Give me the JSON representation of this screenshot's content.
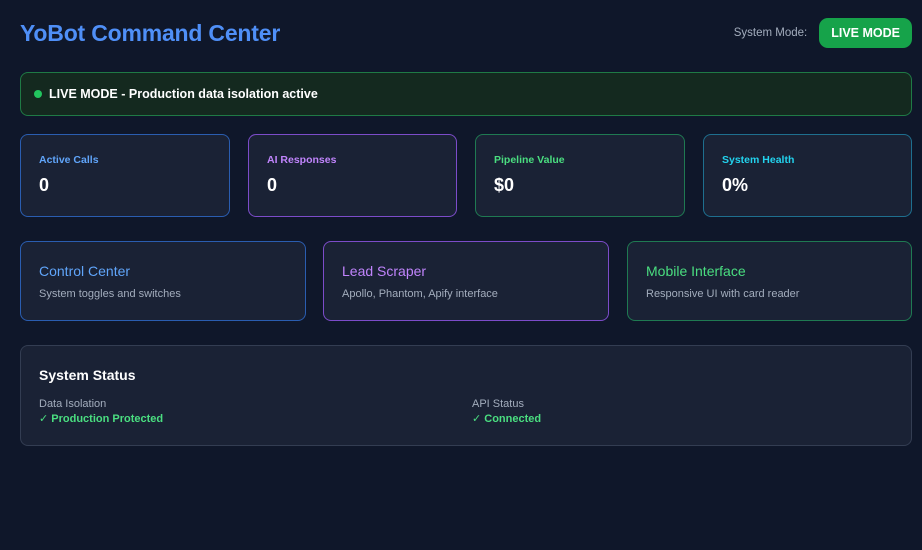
{
  "header": {
    "title": "YoBot Command Center",
    "mode_label": "System Mode:",
    "mode_button": "LIVE MODE"
  },
  "banner": {
    "text": "LIVE MODE - Production data isolation active"
  },
  "stats": [
    {
      "label": "Active Calls",
      "value": "0"
    },
    {
      "label": "AI Responses",
      "value": "0"
    },
    {
      "label": "Pipeline Value",
      "value": "$0"
    },
    {
      "label": "System Health",
      "value": "0%"
    }
  ],
  "features": [
    {
      "title": "Control Center",
      "description": "System toggles and switches"
    },
    {
      "title": "Lead Scraper",
      "description": "Apollo, Phantom, Apify interface"
    },
    {
      "title": "Mobile Interface",
      "description": "Responsive UI with card reader"
    }
  ],
  "system_status": {
    "title": "System Status",
    "items": [
      {
        "label": "Data Isolation",
        "value": "✓ Production Protected"
      },
      {
        "label": "API Status",
        "value": "✓ Connected"
      }
    ]
  },
  "colors": {
    "background": "#0f172a",
    "card": "#1a2235",
    "accent_blue": "#4f8ff7",
    "live_green": "#16a34a",
    "purple": "#c084fc",
    "cyan": "#22d3ee"
  }
}
